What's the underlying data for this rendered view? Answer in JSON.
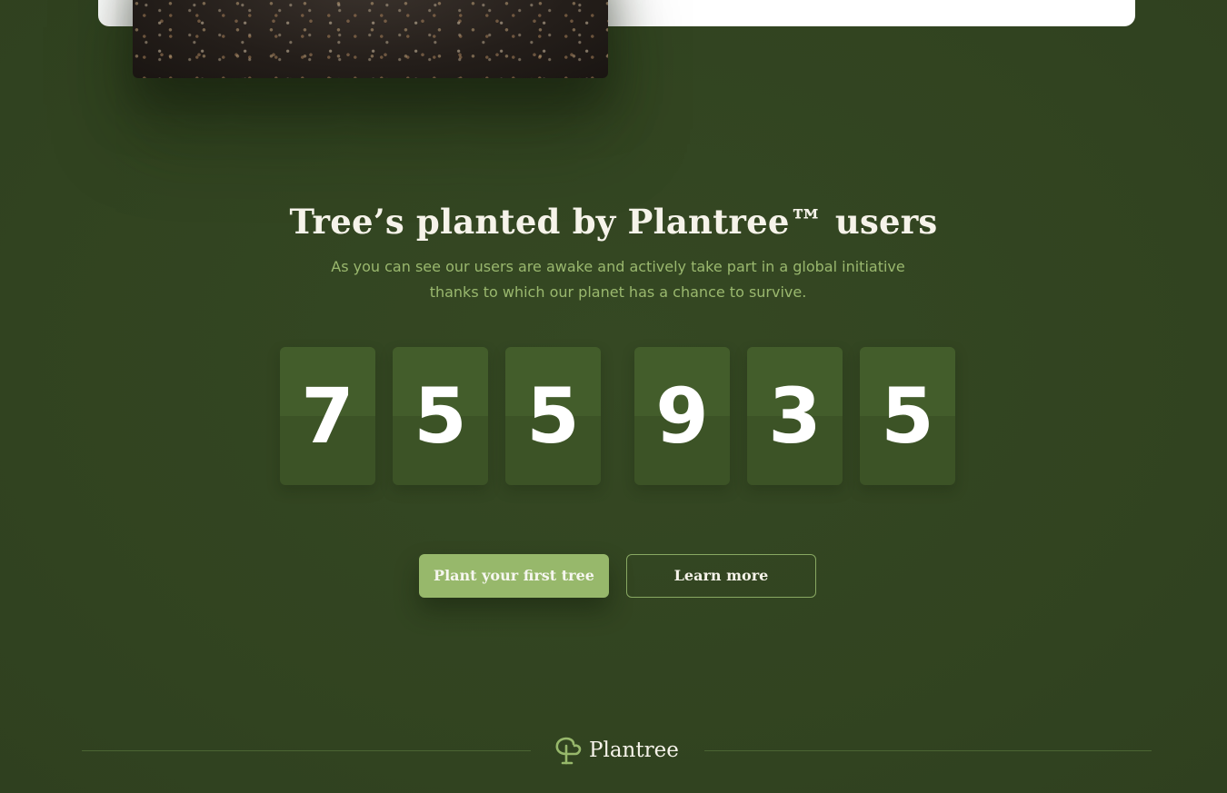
{
  "hero": {
    "image_alt": "soil"
  },
  "stats": {
    "title": "Tree’s planted by Plantree™ users",
    "subtitle": "As you can see our users are awake and actively take part in a global initiative thanks to which our planet has a chance to survive.",
    "digits": [
      "7",
      "5",
      "5",
      "9",
      "3",
      "5"
    ]
  },
  "actions": {
    "primary_label": "Plant your first tree",
    "secondary_label": "Learn more"
  },
  "footer": {
    "brand": "Plantree",
    "logo_icon": "tree-sprout-icon"
  },
  "colors": {
    "background": "#334621",
    "accent": "#97b86b",
    "text": "#f6f3ea",
    "muted_text": "#9ab86e"
  }
}
